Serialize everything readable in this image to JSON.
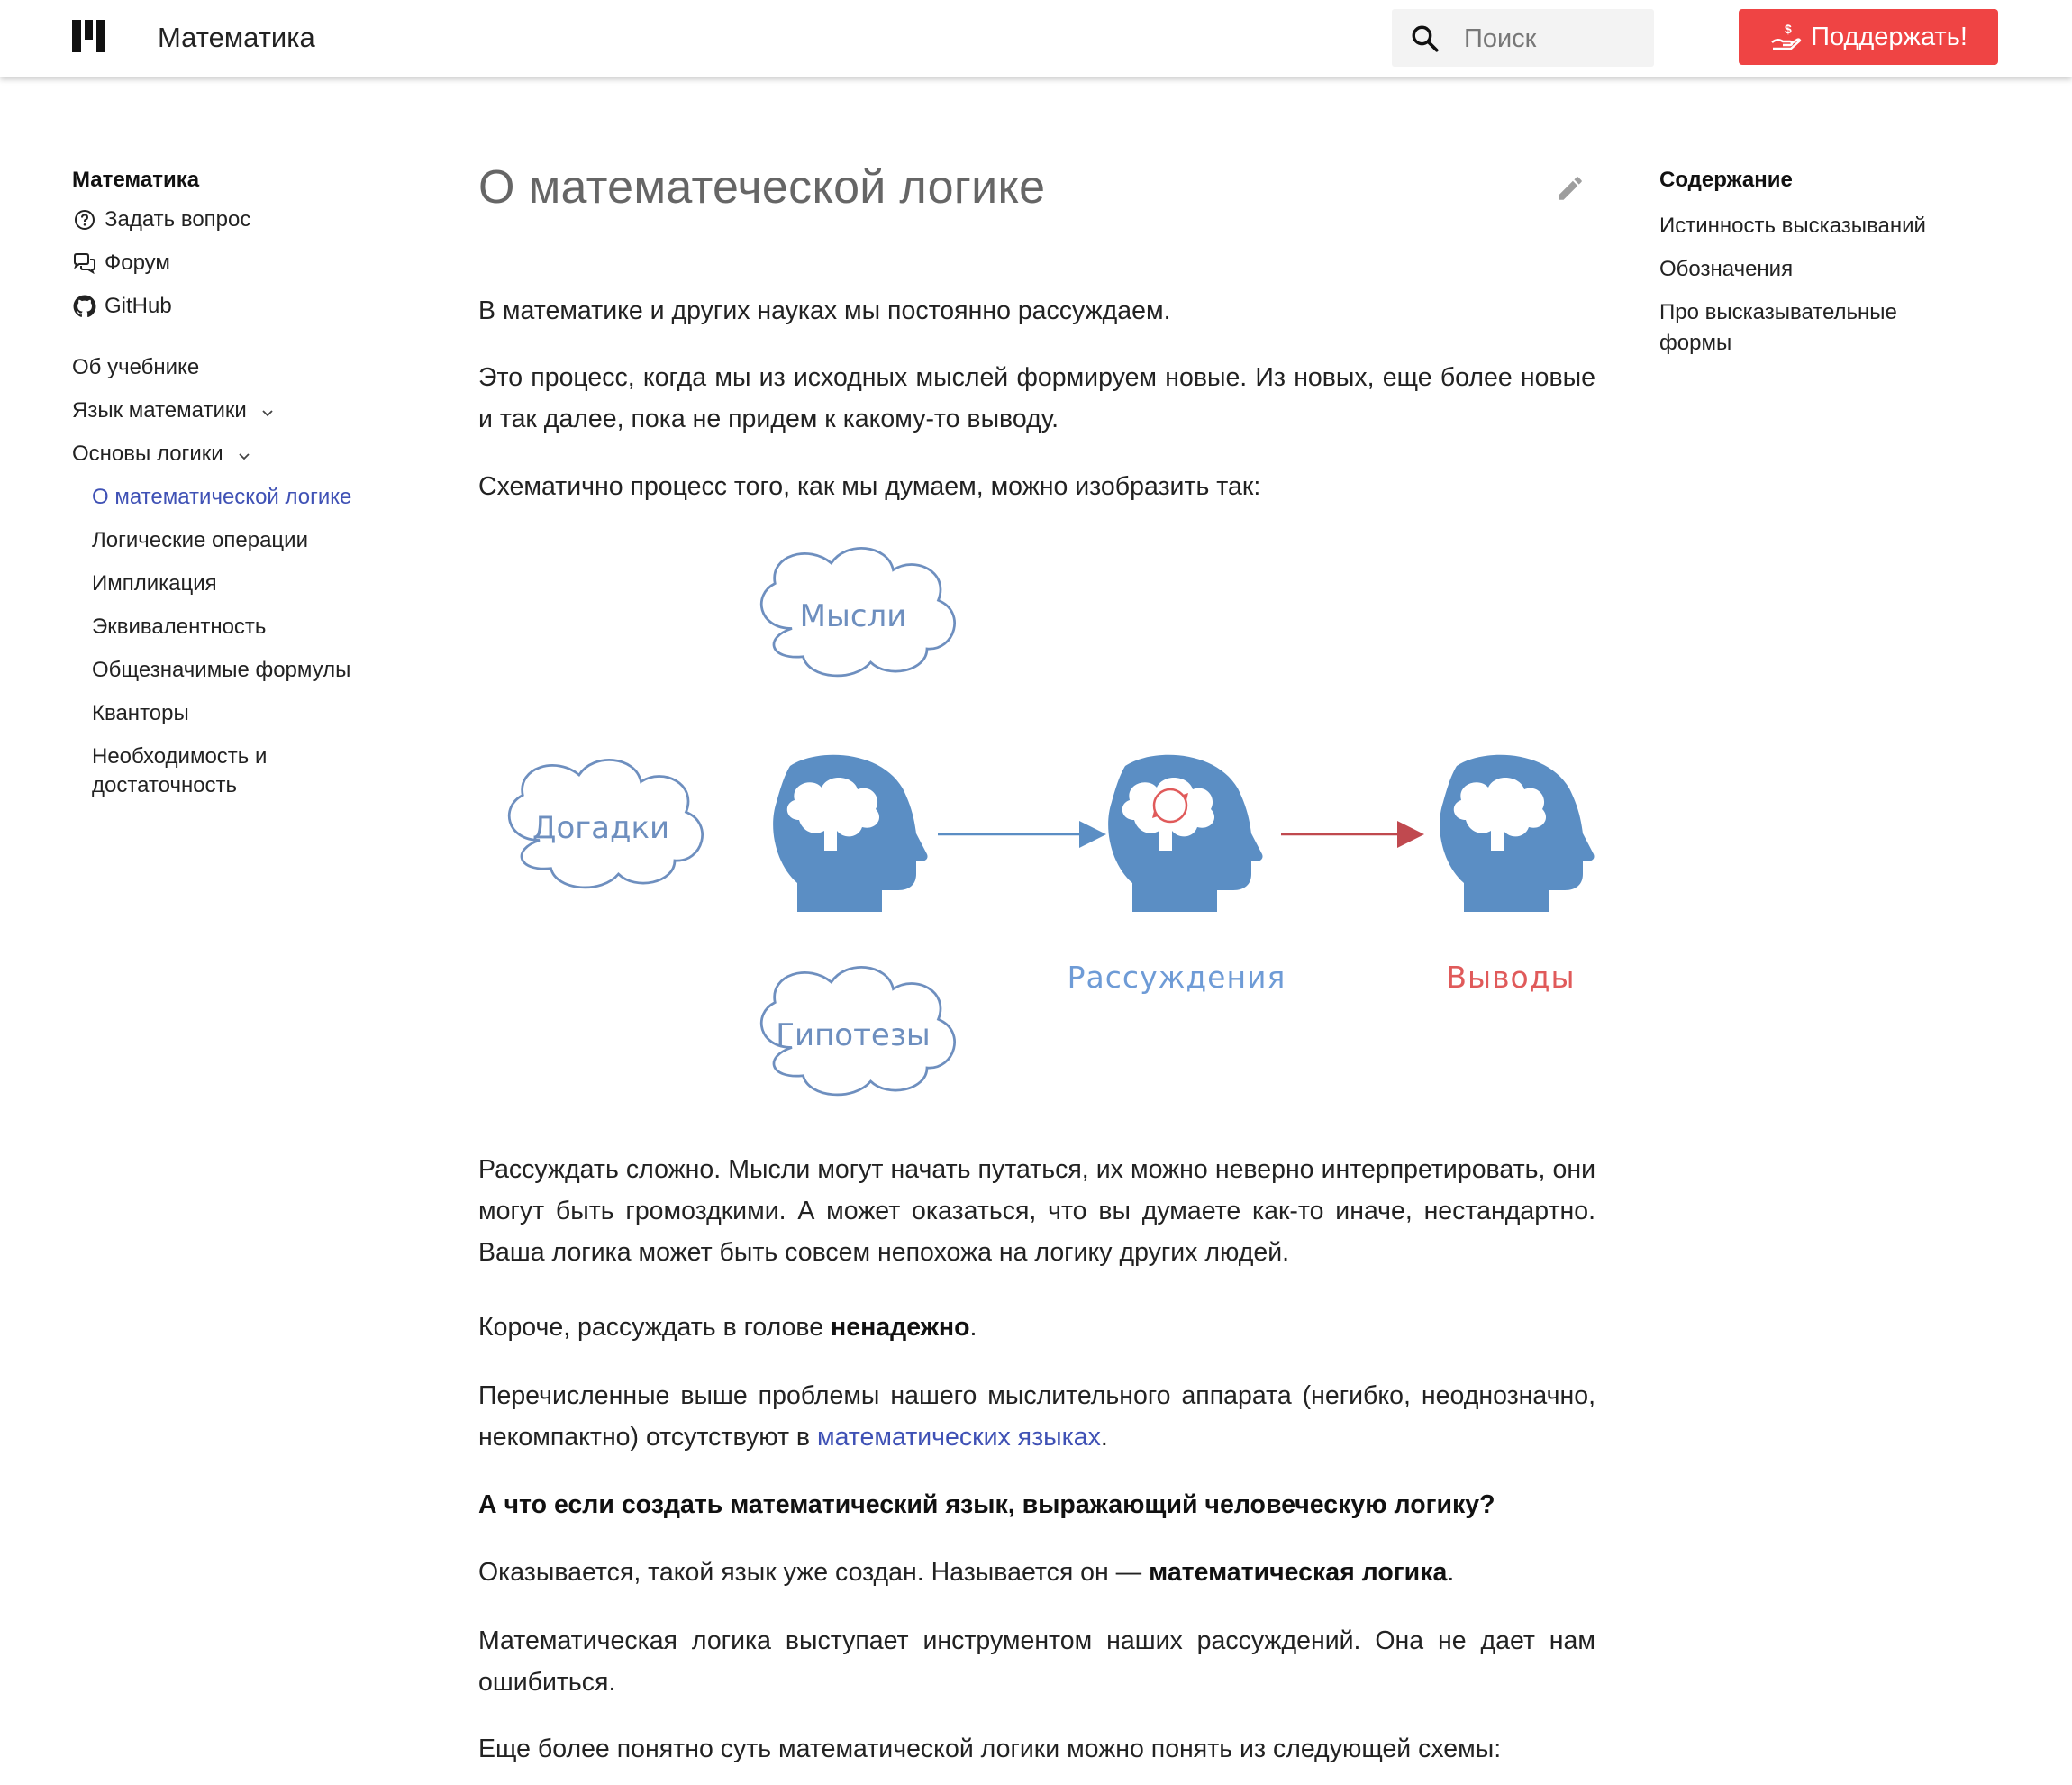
{
  "header": {
    "app_title": "Математика",
    "search_placeholder": "Поиск",
    "donate_label": "Поддержать!",
    "donate_color": "#ef4444"
  },
  "leftnav": {
    "title": "Математика",
    "links": [
      {
        "label": "Задать вопрос",
        "icon": "help-circle-icon"
      },
      {
        "label": "Форум",
        "icon": "forum-icon"
      },
      {
        "label": "GitHub",
        "icon": "github-icon"
      }
    ],
    "sections": [
      {
        "label": "Об учебнике"
      },
      {
        "label": "Язык математики"
      },
      {
        "label": "Основы логики"
      }
    ],
    "subitems": [
      {
        "label": "О математической логике",
        "active": true
      },
      {
        "label": "Логические операции"
      },
      {
        "label": "Импликация"
      },
      {
        "label": "Эквивалентность"
      },
      {
        "label": "Общезначимые формулы"
      },
      {
        "label": "Кванторы"
      },
      {
        "label": "Необходимость и достаточность"
      }
    ],
    "active_color": "#3f51b5"
  },
  "toc": {
    "title": "Содержание",
    "items": [
      "Истинность высказываний",
      "Обозначения",
      "Про высказывательные формы"
    ]
  },
  "article": {
    "title": "О математеческой логике",
    "p1": "В математике и других науках мы постоянно рассуждаем.",
    "p2": "Это процесс, когда мы из исходных мыслей формируем новые. Из новых, еще более новые и так далее, пока не придем к какому-то выводу.",
    "p3": "Схематично процесс того, как мы думаем, можно изобразить так:",
    "p4": "Рассуждать сложно. Мысли могут начать путаться, их можно неверно интерпретировать, они могут быть громоздкими. А может оказаться, что вы думаете как-то иначе, нестандартно. Ваша логика может быть совсем непохожа на логику других людей.",
    "p5_pre": "Короче, рассуждать в голове ",
    "p5_bold": "ненадежно",
    "p5_post": ".",
    "p6_pre": "Перечисленные выше проблемы нашего мыслительного аппарата (негибко, неоднозначно, некомпактно) отсутствуют в ",
    "p6_link": "математических языках",
    "p6_post": ".",
    "p7_bold": "А что если создать математический язык, выражающий человеческую логику?",
    "p8_pre": "Оказывается, такой язык уже создан. Называется он — ",
    "p8_bold": "математическая логика",
    "p8_post": ".",
    "p9": "Математическая логика выступает инструментом наших рассуждений. Она не дает нам ошибиться.",
    "p10": "Еще более понятно суть математической логики можно понять из следующей схемы:"
  },
  "diagram": {
    "clouds": [
      "Мысли",
      "Догадки",
      "Гипотезы"
    ],
    "label_reasoning": "Рассуждения",
    "label_conclusions": "Выводы",
    "blue": "#5b8ec4",
    "red": "#e05a5a",
    "arrow_red": "#c0494f",
    "cloud_text": "#6e8fbf"
  }
}
